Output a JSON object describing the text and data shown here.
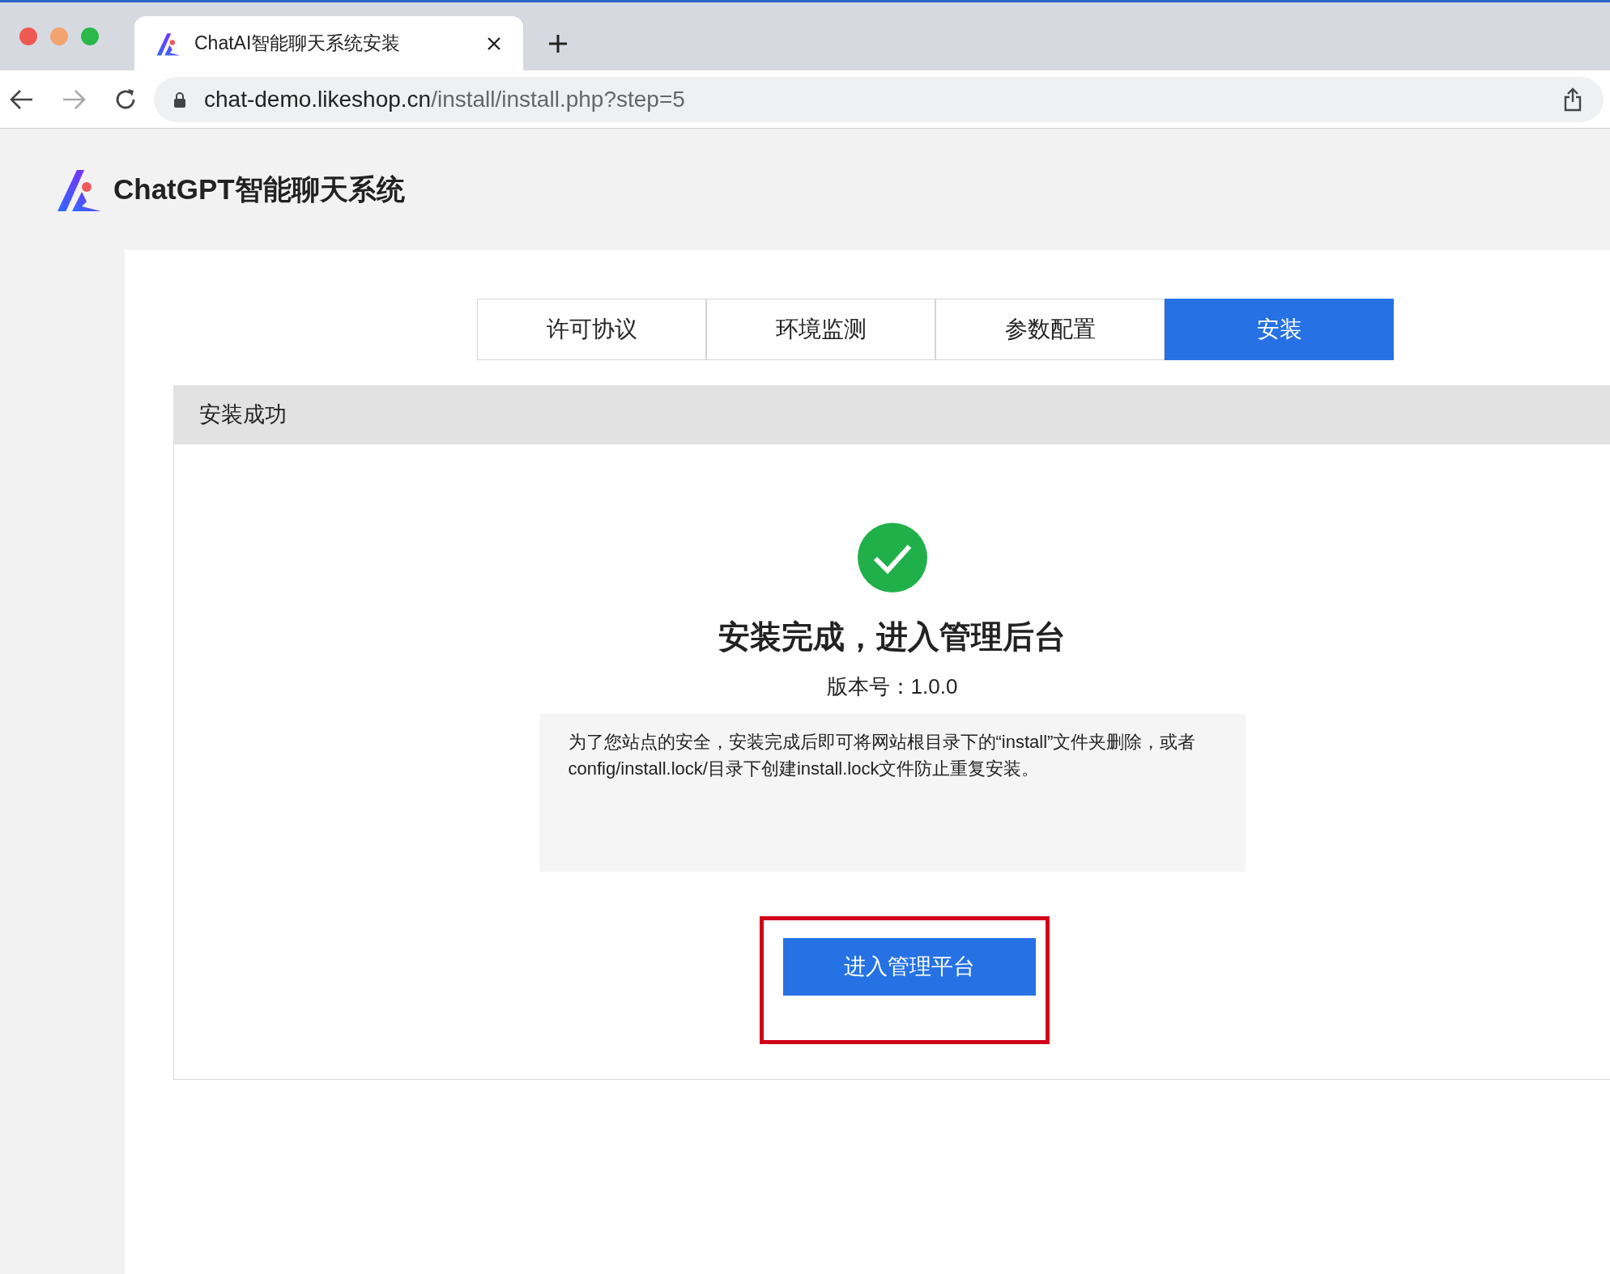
{
  "browser": {
    "tab_title": "ChatAI智能聊天系统安装",
    "url_host": "chat-demo.likeshop.cn",
    "url_path": "/install/install.php?step=5"
  },
  "brand": {
    "title": "ChatGPT智能聊天系统"
  },
  "steps": [
    {
      "label": "许可协议",
      "selected": false
    },
    {
      "label": "环境监测",
      "selected": false
    },
    {
      "label": "参数配置",
      "selected": false
    },
    {
      "label": "安装",
      "selected": true
    }
  ],
  "section": {
    "title": "安装成功"
  },
  "result": {
    "heading": "安装完成，进入管理后台",
    "version": "版本号：1.0.0",
    "notice": "为了您站点的安全，安装完成后即可将网站根目录下的“install”文件夹删除，或者config/install.lock/目录下创建install.lock文件防止重复安装。",
    "button": "进入管理平台"
  }
}
